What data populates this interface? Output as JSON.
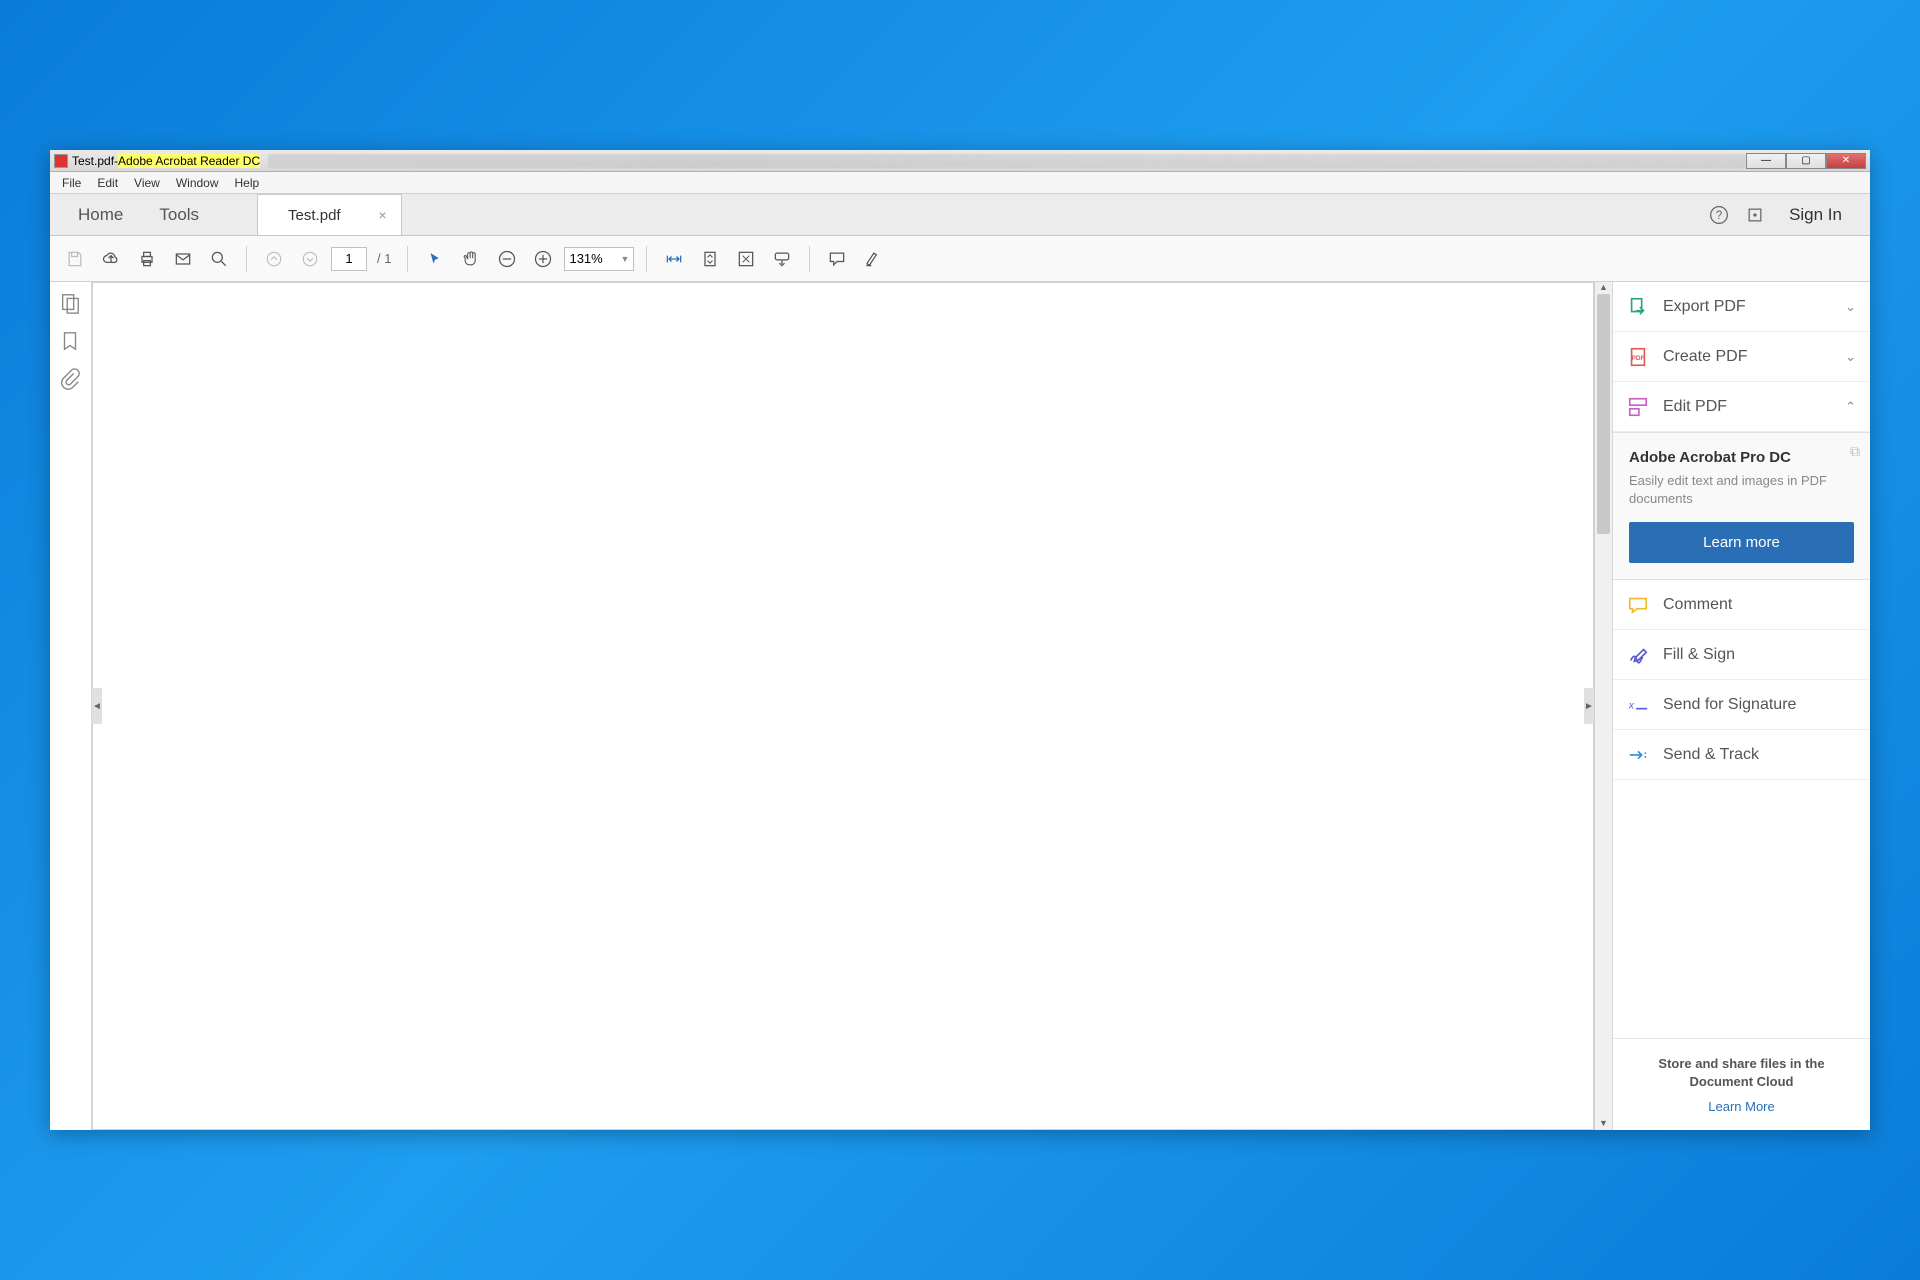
{
  "titlebar": {
    "filename": "Test.pdf",
    "separator": " - ",
    "appname": "Adobe Acrobat Reader DC"
  },
  "menubar": [
    "File",
    "Edit",
    "View",
    "Window",
    "Help"
  ],
  "tabbar": {
    "home": "Home",
    "tools": "Tools",
    "doc_tab": "Test.pdf",
    "signin": "Sign In"
  },
  "toolbar": {
    "page_current": "1",
    "page_total": "/ 1",
    "zoom": "131%"
  },
  "right_panel": {
    "tools": [
      {
        "label": "Export PDF",
        "icon_color": "#2aa876",
        "expanded": false
      },
      {
        "label": "Create PDF",
        "icon_color": "#e05a5a",
        "expanded": false
      },
      {
        "label": "Edit PDF",
        "icon_color": "#c860c8",
        "expanded": true
      }
    ],
    "promo": {
      "title": "Adobe Acrobat Pro DC",
      "desc": "Easily edit text and images in PDF documents",
      "button": "Learn more"
    },
    "actions": [
      {
        "label": "Comment",
        "icon_color": "#f0b828"
      },
      {
        "label": "Fill & Sign",
        "icon_color": "#5a5ad8"
      },
      {
        "label": "Send for Signature",
        "icon_color": "#5a5ad8"
      },
      {
        "label": "Send & Track",
        "icon_color": "#3090d8"
      }
    ],
    "footer": {
      "title": "Store and share files in the Document Cloud",
      "link": "Learn More"
    }
  }
}
